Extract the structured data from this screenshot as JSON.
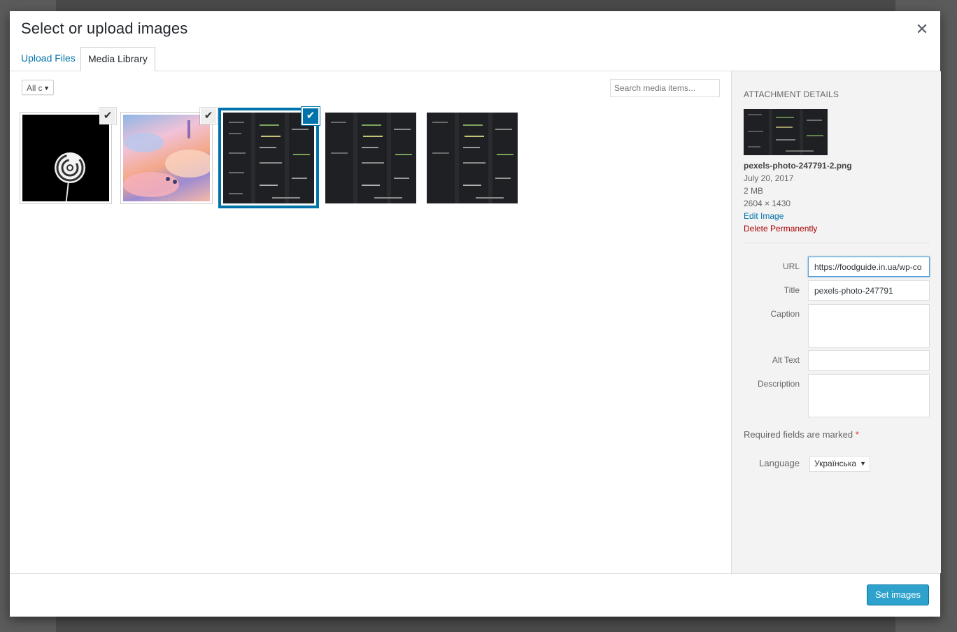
{
  "modal": {
    "title": "Select or upload images",
    "close_icon": "close-icon"
  },
  "tabs": [
    {
      "label": "Upload Files",
      "active": false
    },
    {
      "label": "Media Library",
      "active": true
    }
  ],
  "toolbar_top": {
    "filter_value": "All c",
    "search_placeholder": "Search media items..."
  },
  "attachments": [
    {
      "image": "white spiral lollipop on black",
      "checked": true,
      "details": false
    },
    {
      "image": "pastel fantasy sky with clouds",
      "checked": true,
      "details": false
    },
    {
      "image": "code on dark screen",
      "checked": true,
      "details": true
    },
    {
      "image": "code on dark screen",
      "checked": false,
      "details": false
    },
    {
      "image": "code on dark screen",
      "checked": false,
      "details": false
    }
  ],
  "sidebar": {
    "heading": "Attachment Details",
    "filename": "pexels-photo-247791-2.png",
    "date": "July 20, 2017",
    "size": "2 MB",
    "dimensions": "2604 × 1430",
    "edit_link": "Edit Image",
    "delete_link": "Delete Permanently",
    "fields": {
      "url_label": "URL",
      "url_value": "https://foodguide.in.ua/wp-co",
      "title_label": "Title",
      "title_value": "pexels-photo-247791",
      "caption_label": "Caption",
      "caption_value": "",
      "alt_label": "Alt Text",
      "alt_value": "",
      "description_label": "Description",
      "description_value": ""
    },
    "required_note": "Required fields are marked",
    "required_star": "*",
    "language_label": "Language",
    "language_value": "Українська"
  },
  "footer": {
    "primary_button": "Set images"
  },
  "colors": {
    "accent": "#0073aa",
    "primary_button": "#2ea2cc",
    "delete": "#aa0000"
  }
}
